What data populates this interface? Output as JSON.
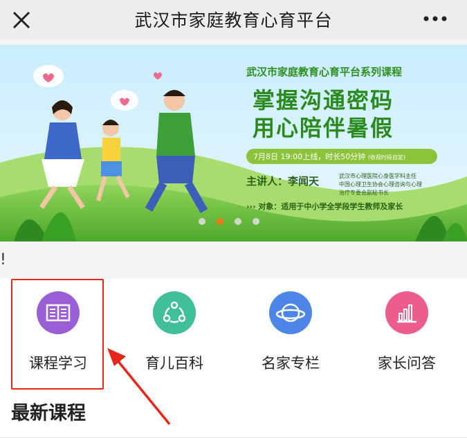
{
  "header": {
    "title": "武汉市家庭教育心育平台",
    "close_icon": "close-icon",
    "more_icon": "more-icon"
  },
  "banner": {
    "series_title": "武汉市家庭教育心育平台系列课程",
    "headline_1": "掌握沟通密码",
    "headline_2": "用心陪伴暑假",
    "schedule": "7月8日  19:00上线，时长50分钟",
    "schedule_note": "(收视时段自定)",
    "speaker_label": "主讲人：李闻天",
    "speaker_title_1": "武汉市心理医院心身医学科主任",
    "speaker_title_2": "中国心理卫生协会心理咨询与心理",
    "speaker_title_3": "治疗专委会副秘书长",
    "audience": "››› 对象：适用于中小学全学段学生教师及家长",
    "carousel_active_index": 1,
    "carousel_count": 4
  },
  "notice": {
    "text": "!"
  },
  "menu": {
    "items": [
      {
        "label": "课程学习",
        "icon": "book-icon",
        "color": "#9a5fd7"
      },
      {
        "label": "育儿百科",
        "icon": "nodes-icon",
        "color": "#3fbf9a"
      },
      {
        "label": "名家专栏",
        "icon": "planet-icon",
        "color": "#4d86e8"
      },
      {
        "label": "家长问答",
        "icon": "bar-chart-icon",
        "color": "#ea5d8c"
      }
    ]
  },
  "section": {
    "title": "最新课程"
  },
  "colors": {
    "highlight": "#e8251a",
    "banner_green": "#2f8f1f",
    "banner_sky": "#bfe9ff"
  }
}
